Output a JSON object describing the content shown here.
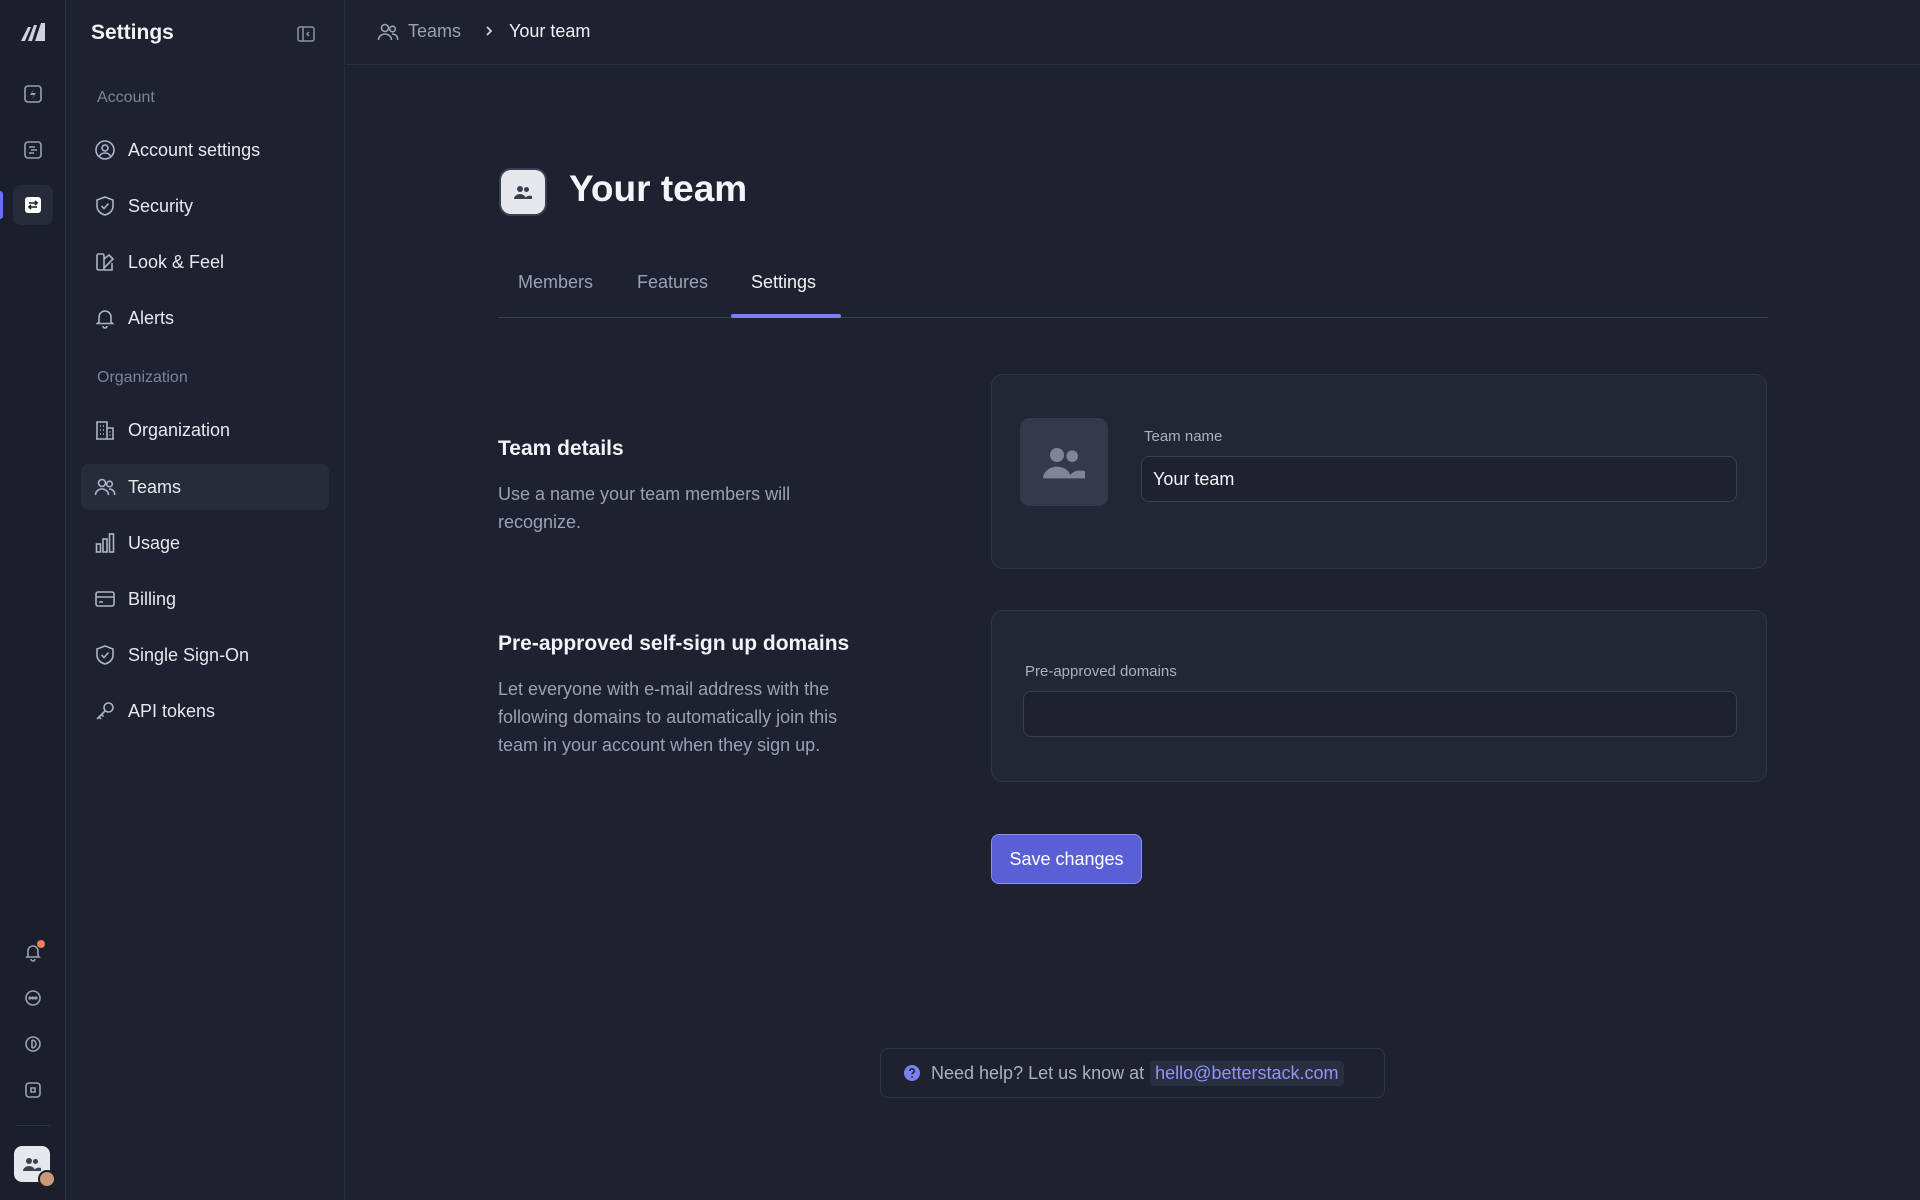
{
  "sidebar": {
    "title": "Settings",
    "sections": [
      {
        "label": "Account",
        "items": [
          {
            "label": "Account settings",
            "icon": "user-circle-icon"
          },
          {
            "label": "Security",
            "icon": "shield-check-icon"
          },
          {
            "label": "Look & Feel",
            "icon": "palette-icon"
          },
          {
            "label": "Alerts",
            "icon": "bell-icon"
          }
        ]
      },
      {
        "label": "Organization",
        "items": [
          {
            "label": "Organization",
            "icon": "building-icon"
          },
          {
            "label": "Teams",
            "icon": "users-icon",
            "active": true
          },
          {
            "label": "Usage",
            "icon": "bar-chart-icon"
          },
          {
            "label": "Billing",
            "icon": "credit-card-icon"
          },
          {
            "label": "Single Sign-On",
            "icon": "shield-check-icon"
          },
          {
            "label": "API tokens",
            "icon": "key-icon"
          }
        ]
      }
    ]
  },
  "breadcrumb": {
    "parent": "Teams",
    "current": "Your team"
  },
  "page": {
    "title": "Your team",
    "tabs": [
      {
        "label": "Members",
        "active": false
      },
      {
        "label": "Features",
        "active": false
      },
      {
        "label": "Settings",
        "active": true
      }
    ]
  },
  "team_details": {
    "heading": "Team details",
    "description": "Use a name your team members will recognize.",
    "field_label": "Team name",
    "field_value": "Your team"
  },
  "domains": {
    "heading": "Pre-approved self-sign up domains",
    "description": "Let everyone with e-mail address with the following domains to automatically join this team in your account when they sign up.",
    "field_label": "Pre-approved domains",
    "field_value": ""
  },
  "actions": {
    "save_label": "Save changes"
  },
  "help": {
    "text": "Need help? Let us know at",
    "email": "hello@betterstack.com"
  },
  "colors": {
    "accent": "#5b5fd6",
    "tab_underline": "#7b7ff0",
    "notification_dot": "#f07e5a",
    "background": "#1e2230"
  }
}
